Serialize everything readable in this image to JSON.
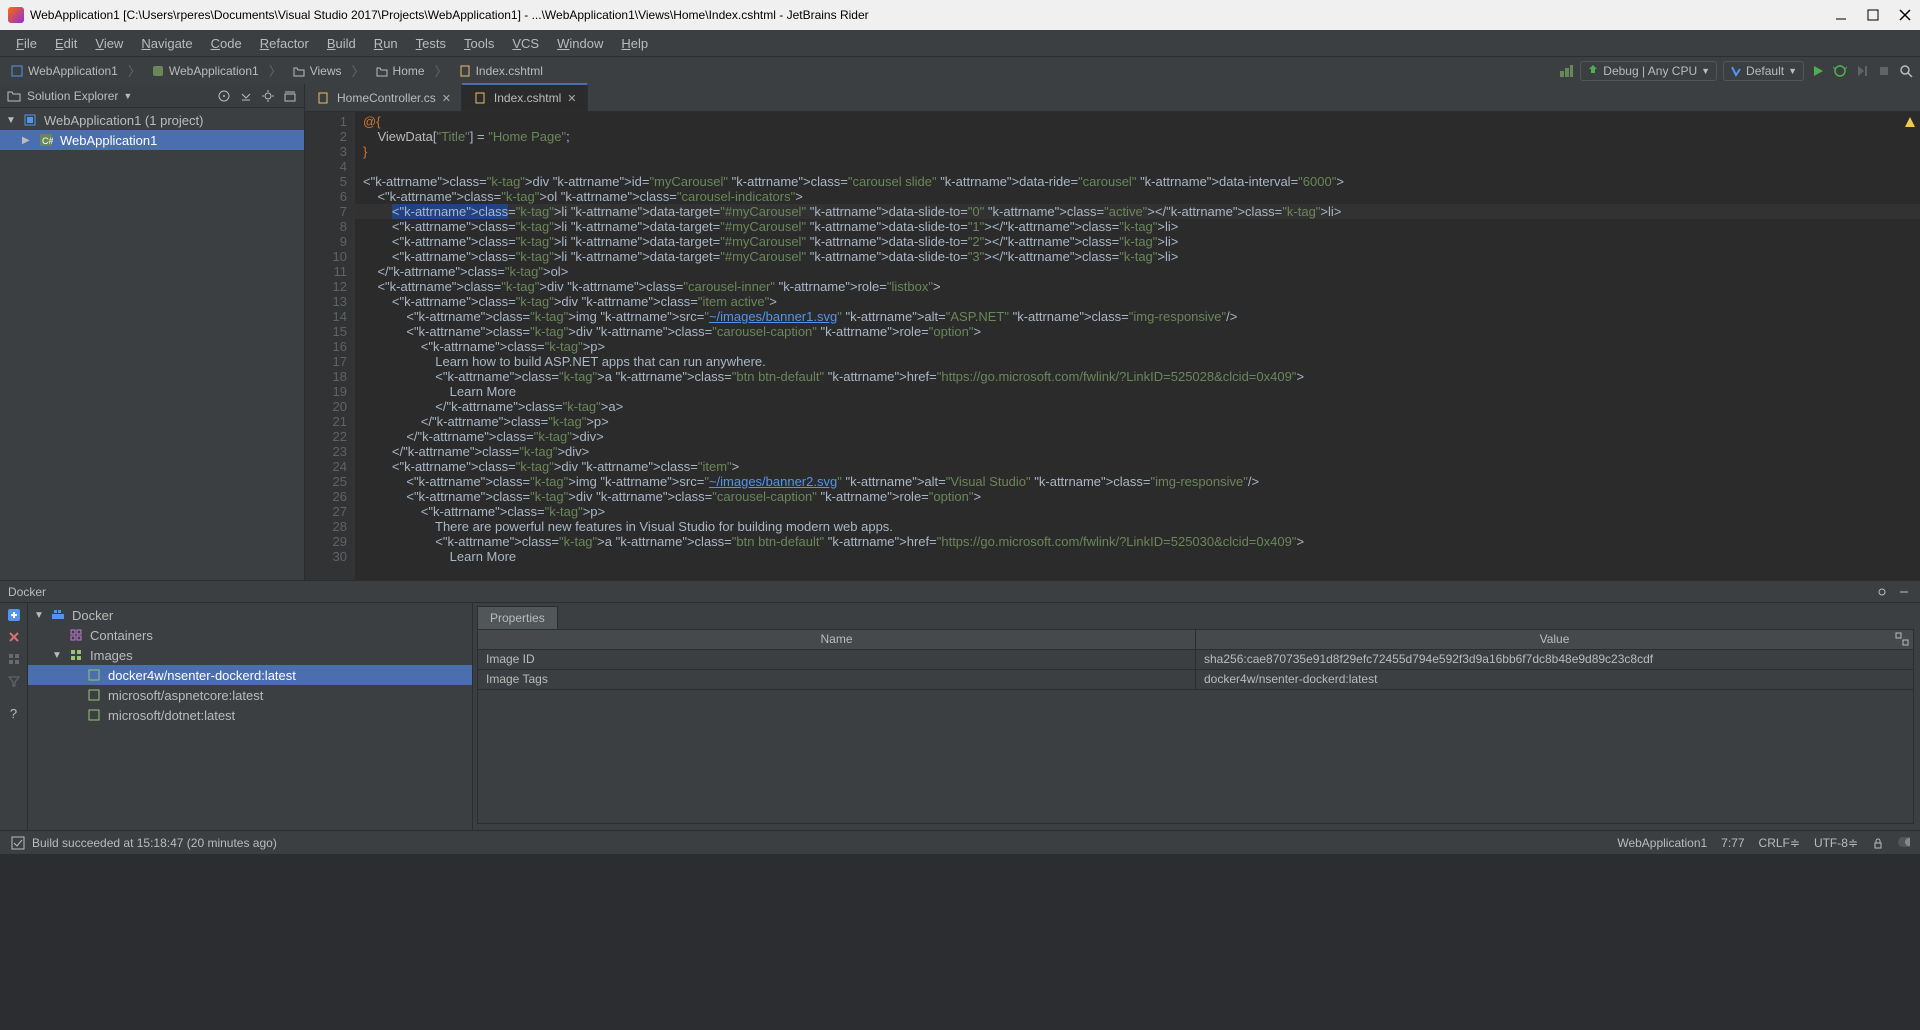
{
  "window": {
    "title": "WebApplication1 [C:\\Users\\rperes\\Documents\\Visual Studio 2017\\Projects\\WebApplication1] - ...\\WebApplication1\\Views\\Home\\Index.cshtml - JetBrains Rider"
  },
  "menu": [
    "File",
    "Edit",
    "View",
    "Navigate",
    "Code",
    "Refactor",
    "Build",
    "Run",
    "Tests",
    "Tools",
    "VCS",
    "Window",
    "Help"
  ],
  "breadcrumb": {
    "items": [
      "WebApplication1",
      "WebApplication1",
      "Views",
      "Home",
      "Index.cshtml"
    ]
  },
  "runConfig": {
    "mode": "Debug | Any CPU",
    "config": "Default"
  },
  "explorer": {
    "title": "Solution Explorer",
    "root": "WebApplication1 (1 project)",
    "child": "WebApplication1"
  },
  "tabs": [
    {
      "label": "HomeController.cs",
      "active": false
    },
    {
      "label": "Index.cshtml",
      "active": true
    }
  ],
  "code": {
    "lines": [
      {
        "n": 1,
        "c": "@{"
      },
      {
        "n": 2,
        "c": "    ViewData[\"Title\"] = \"Home Page\";"
      },
      {
        "n": 3,
        "c": "}"
      },
      {
        "n": 4,
        "c": ""
      },
      {
        "n": 5,
        "c": "<div id=\"myCarousel\" class=\"carousel slide\" data-ride=\"carousel\" data-interval=\"6000\">"
      },
      {
        "n": 6,
        "c": "    <ol class=\"carousel-indicators\">"
      },
      {
        "n": 7,
        "c": "        <li data-target=\"#myCarousel\" data-slide-to=\"0\" class=\"active\"></li>",
        "hl": true
      },
      {
        "n": 8,
        "c": "        <li data-target=\"#myCarousel\" data-slide-to=\"1\"></li>"
      },
      {
        "n": 9,
        "c": "        <li data-target=\"#myCarousel\" data-slide-to=\"2\"></li>"
      },
      {
        "n": 10,
        "c": "        <li data-target=\"#myCarousel\" data-slide-to=\"3\"></li>"
      },
      {
        "n": 11,
        "c": "    </ol>"
      },
      {
        "n": 12,
        "c": "    <div class=\"carousel-inner\" role=\"listbox\">"
      },
      {
        "n": 13,
        "c": "        <div class=\"item active\">"
      },
      {
        "n": 14,
        "c": "            <img src=\"~/images/banner1.svg\" alt=\"ASP.NET\" class=\"img-responsive\"/>"
      },
      {
        "n": 15,
        "c": "            <div class=\"carousel-caption\" role=\"option\">"
      },
      {
        "n": 16,
        "c": "                <p>"
      },
      {
        "n": 17,
        "c": "                    Learn how to build ASP.NET apps that can run anywhere."
      },
      {
        "n": 18,
        "c": "                    <a class=\"btn btn-default\" href=\"https://go.microsoft.com/fwlink/?LinkID=525028&clcid=0x409\">"
      },
      {
        "n": 19,
        "c": "                        Learn More"
      },
      {
        "n": 20,
        "c": "                    </a>"
      },
      {
        "n": 21,
        "c": "                </p>"
      },
      {
        "n": 22,
        "c": "            </div>"
      },
      {
        "n": 23,
        "c": "        </div>"
      },
      {
        "n": 24,
        "c": "        <div class=\"item\">"
      },
      {
        "n": 25,
        "c": "            <img src=\"~/images/banner2.svg\" alt=\"Visual Studio\" class=\"img-responsive\"/>"
      },
      {
        "n": 26,
        "c": "            <div class=\"carousel-caption\" role=\"option\">"
      },
      {
        "n": 27,
        "c": "                <p>"
      },
      {
        "n": 28,
        "c": "                    There are powerful new features in Visual Studio for building modern web apps."
      },
      {
        "n": 29,
        "c": "                    <a class=\"btn btn-default\" href=\"https://go.microsoft.com/fwlink/?LinkID=525030&clcid=0x409\">"
      },
      {
        "n": 30,
        "c": "                        Learn More"
      }
    ]
  },
  "docker": {
    "title": "Docker",
    "root": "Docker",
    "nodes": {
      "containers": "Containers",
      "images": "Images"
    },
    "images": [
      "docker4w/nsenter-dockerd:latest",
      "microsoft/aspnetcore:latest",
      "microsoft/dotnet:latest"
    ],
    "selectedIndex": 0,
    "propertiesTab": "Properties",
    "columns": {
      "name": "Name",
      "value": "Value"
    },
    "rows": [
      {
        "name": "Image ID",
        "value": "sha256:cae870735e91d8f29efc72455d794e592f3d9a16bb6f7dc8b48e9d89c23c8cdf"
      },
      {
        "name": "Image Tags",
        "value": "docker4w/nsenter-dockerd:latest"
      }
    ]
  },
  "status": {
    "build": "Build succeeded at 15:18:47 (20 minutes ago)",
    "project": "WebApplication1",
    "caret": "7:77",
    "lineEnd": "CRLF",
    "encoding": "UTF-8"
  }
}
